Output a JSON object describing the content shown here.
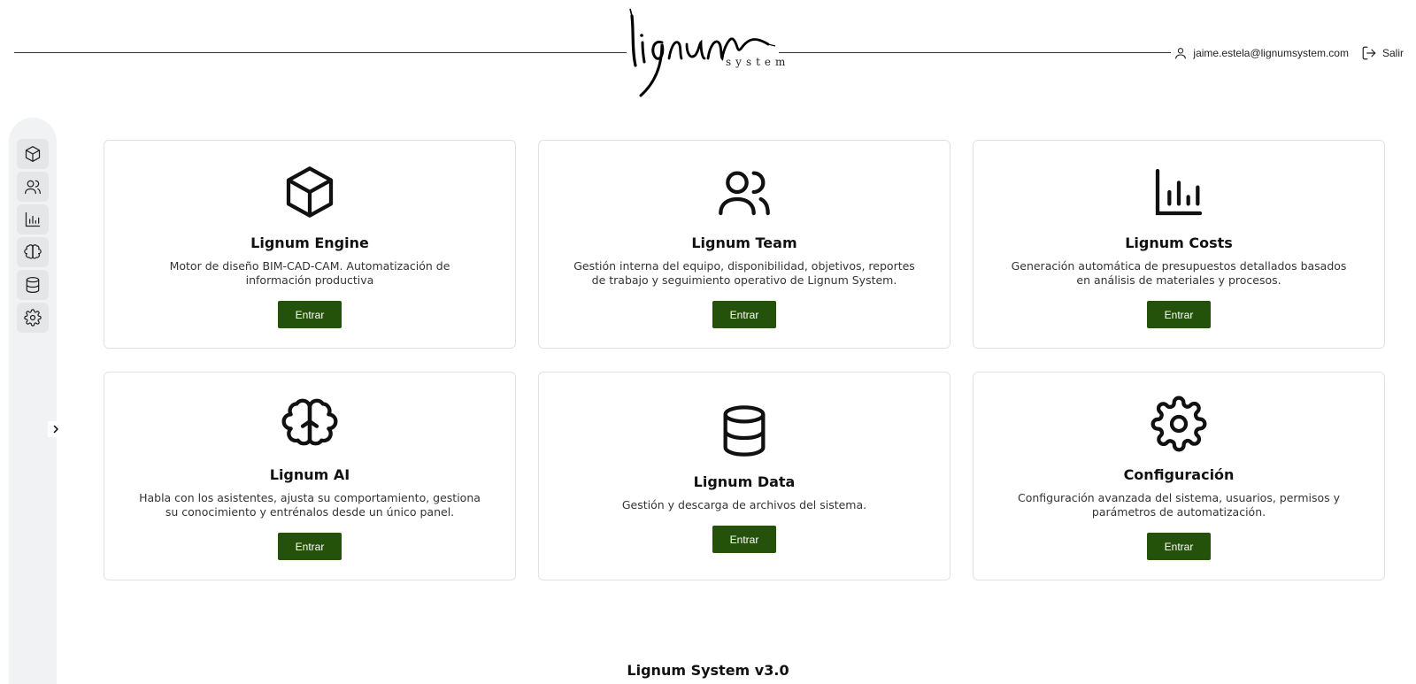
{
  "header": {
    "logo_text": "lignum",
    "logo_subtext": "system",
    "user_email": "jaime.estela@lignumsystem.com",
    "logout_label": "Salir",
    "user_icon": "user-icon",
    "logout_icon": "logout-icon"
  },
  "sidebar": {
    "items": [
      {
        "icon": "box-icon"
      },
      {
        "icon": "users-icon"
      },
      {
        "icon": "bar-chart-icon"
      },
      {
        "icon": "brain-icon"
      },
      {
        "icon": "database-icon"
      },
      {
        "icon": "gear-icon"
      }
    ],
    "toggle_icon": "chevron-right-icon"
  },
  "cards": [
    {
      "title": "Lignum Engine",
      "description": "Motor de diseño BIM-CAD-CAM. Automatización de información productiva",
      "button": "Entrar",
      "icon": "box-icon"
    },
    {
      "title": "Lignum Team",
      "description": "Gestión interna del equipo, disponibilidad, objetivos, reportes de trabajo y seguimiento operativo de Lignum System.",
      "button": "Entrar",
      "icon": "users-icon"
    },
    {
      "title": "Lignum Costs",
      "description": "Generación automática de presupuestos detallados basados en análisis de materiales y procesos.",
      "button": "Entrar",
      "icon": "bar-chart-icon"
    },
    {
      "title": "Lignum AI",
      "description": "Habla con los asistentes, ajusta su comportamiento, gestiona su conocimiento y entrénalos desde un único panel.",
      "button": "Entrar",
      "icon": "brain-icon"
    },
    {
      "title": "Lignum Data",
      "description": "Gestión y descarga de archivos del sistema.",
      "button": "Entrar",
      "icon": "database-icon"
    },
    {
      "title": "Configuración",
      "description": "Configuración avanzada del sistema, usuarios, permisos y parámetros de automatización.",
      "button": "Entrar",
      "icon": "gear-icon"
    }
  ],
  "footer": {
    "text": "Lignum System v3.0"
  },
  "colors": {
    "button_bg": "#24520b",
    "sidebar_bg": "#f1f2f3"
  }
}
